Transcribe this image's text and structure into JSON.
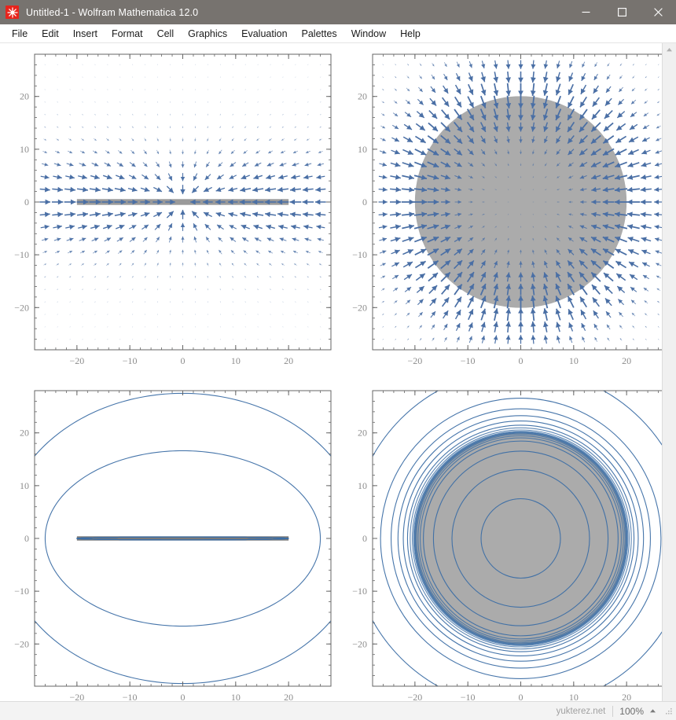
{
  "window": {
    "title": "Untitled-1 - Wolfram Mathematica 12.0",
    "app_icon": "mathematica-spikey-icon",
    "titlebar_color": "#77736f",
    "controls": {
      "minimize": "minimize-icon",
      "maximize": "maximize-icon",
      "close": "close-icon"
    }
  },
  "menubar": {
    "items": [
      {
        "label": "File"
      },
      {
        "label": "Edit"
      },
      {
        "label": "Insert"
      },
      {
        "label": "Format"
      },
      {
        "label": "Cell"
      },
      {
        "label": "Graphics"
      },
      {
        "label": "Evaluation"
      },
      {
        "label": "Palettes"
      },
      {
        "label": "Window"
      },
      {
        "label": "Help"
      }
    ]
  },
  "statusbar": {
    "watermark": "yukterez.net",
    "zoom": "100%",
    "zoom_caret": "chevron-up-icon",
    "resize_grip": "resize-grip-icon"
  },
  "scrollbar": {
    "up_arrow": "chevron-up-icon",
    "down_arrow": "chevron-down-icon"
  },
  "theme": {
    "accent_blue": "#4a6fa5",
    "contour_blue": "#3c6ea5",
    "disk_gray": "#ababab",
    "frame_gray": "#646464",
    "tick_label_gray": "#8c8c8c"
  },
  "chart_data": [
    {
      "id": "plot-top-left",
      "type": "vectorfield",
      "title": "",
      "xlabel": "",
      "ylabel": "",
      "xlim": [
        -28,
        28
      ],
      "ylim": [
        -28,
        28
      ],
      "xticks": [
        -20,
        -10,
        0,
        10,
        20
      ],
      "yticks": [
        -20,
        -10,
        0,
        10,
        20
      ],
      "xticklabels": [
        "-20",
        "-10",
        "0",
        "10",
        "20"
      ],
      "yticklabels": [
        "-20",
        "-10",
        "0",
        "10",
        "20"
      ],
      "minor_ticks_per_interval": 5,
      "grid": false,
      "frame": true,
      "field": {
        "kind": "kerr-equatorial-inflow",
        "glyph": "arrow",
        "color": "#4a6fa5",
        "samples_x": 23,
        "samples_y": 23,
        "singularity_radius": 20,
        "description": "radially-inward arrows converging on a flat disk along y=0"
      },
      "shapes": [
        {
          "kind": "bar",
          "color": "#9a9a9a",
          "x0": -20,
          "x1": 20,
          "y": 0,
          "thickness": 1.1
        }
      ]
    },
    {
      "id": "plot-top-right",
      "type": "vectorfield",
      "title": "",
      "xlabel": "",
      "ylabel": "",
      "xlim": [
        -28,
        28
      ],
      "ylim": [
        -28,
        28
      ],
      "xticks": [
        -20,
        -10,
        0,
        10,
        20
      ],
      "yticks": [
        -20,
        -10,
        0,
        10,
        20
      ],
      "xticklabels": [
        "-20",
        "-10",
        "0",
        "10",
        "20"
      ],
      "yticklabels": [
        "-20",
        "-10",
        "0",
        "10",
        "20"
      ],
      "minor_ticks_per_interval": 5,
      "grid": false,
      "frame": true,
      "field": {
        "kind": "schwarzschild-radial-inflow",
        "glyph": "arrow",
        "color": "#4a6fa5",
        "samples_x": 23,
        "samples_y": 23,
        "singularity_radius": 20,
        "description": "radially-inward arrows, longest at the horizon r=20"
      },
      "shapes": [
        {
          "kind": "disk",
          "color": "#ababab",
          "cx": 0,
          "cy": 0,
          "r": 20
        }
      ]
    },
    {
      "id": "plot-bottom-left",
      "type": "contour",
      "title": "",
      "xlabel": "",
      "ylabel": "",
      "xlim": [
        -28,
        28
      ],
      "ylim": [
        -28,
        28
      ],
      "xticks": [
        -20,
        -10,
        0,
        10,
        20
      ],
      "yticks": [
        -20,
        -10,
        0,
        10,
        20
      ],
      "xticklabels": [
        "-20",
        "-10",
        "0",
        "10",
        "20"
      ],
      "yticklabels": [
        "-20",
        "-10",
        "0",
        "10",
        "20"
      ],
      "minor_ticks_per_interval": 5,
      "grid": false,
      "frame": true,
      "contours": {
        "kind": "oblate-spheroidal-equipotential",
        "color": "#3c6ea5",
        "levels": [
          34,
          26,
          20,
          15.5,
          13.5,
          12.5
        ],
        "focus": 20,
        "description": "nested oblate ovals collapsing onto the segment y=0, |x|<20 with cusps at the ring x=+-20"
      },
      "shapes": [
        {
          "kind": "bar",
          "color": "#7a7a7a",
          "x0": -20,
          "x1": 20,
          "y": 0,
          "thickness": 0.8
        }
      ]
    },
    {
      "id": "plot-bottom-right",
      "type": "contour",
      "title": "",
      "xlabel": "",
      "ylabel": "",
      "xlim": [
        -28,
        28
      ],
      "ylim": [
        -28,
        28
      ],
      "xticks": [
        -20,
        -10,
        0,
        10,
        20
      ],
      "yticks": [
        -20,
        -10,
        0,
        10,
        20
      ],
      "xticklabels": [
        "-20",
        "-10",
        "0",
        "10",
        "20"
      ],
      "yticklabels": [
        "-20",
        "-10",
        "0",
        "10",
        "20"
      ],
      "minor_ticks_per_interval": 5,
      "grid": false,
      "frame": true,
      "contours": {
        "kind": "schwarzschild-equipotential",
        "color": "#3c6ea5",
        "levels": [
          32,
          26.5,
          24.5,
          23.2,
          22.2,
          21.4,
          20.9,
          20.5,
          20.25,
          20.1,
          20.0,
          19.9,
          19.7,
          19.4,
          19.0,
          18.4,
          16.5,
          13,
          7.5
        ],
        "horizon": 20,
        "description": "concentric circles crowding at the horizon r=20"
      },
      "shapes": [
        {
          "kind": "disk",
          "color": "#ababab",
          "cx": 0,
          "cy": 0,
          "r": 20
        }
      ]
    }
  ]
}
